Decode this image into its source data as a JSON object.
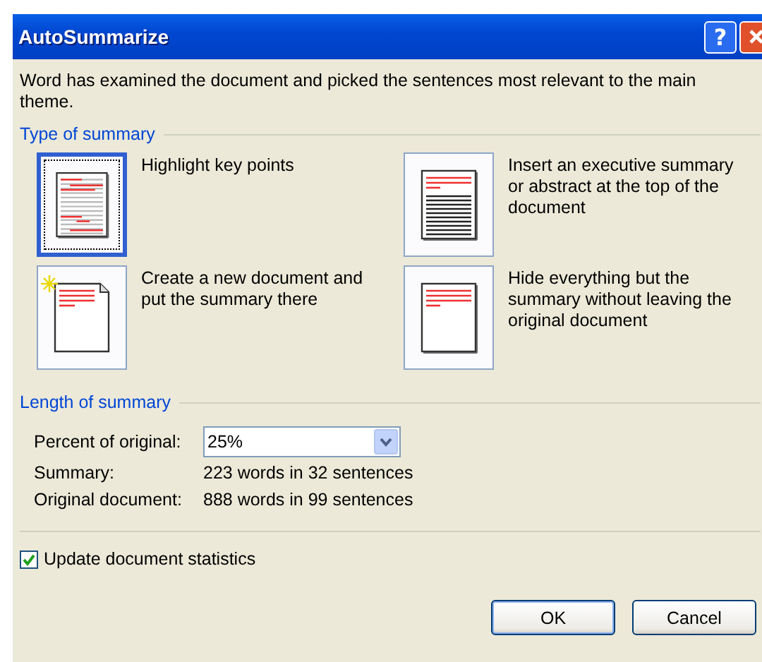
{
  "window": {
    "title": "AutoSummarize",
    "help_button": "?"
  },
  "intro": "Word has examined the document and picked the sentences most relevant to the main theme.",
  "type_of_summary": {
    "label": "Type of summary",
    "options": [
      {
        "kind": "highlight",
        "label": "Highlight key points",
        "selected": true
      },
      {
        "kind": "executive",
        "label": "Insert an executive summary or abstract at the top of the document",
        "selected": false
      },
      {
        "kind": "new-document",
        "label": "Create a new document and put the summary there",
        "selected": false
      },
      {
        "kind": "hide",
        "label": "Hide everything but the summary without leaving the original document",
        "selected": false
      }
    ]
  },
  "length_of_summary": {
    "label": "Length of summary",
    "percent_label": "Percent of original:",
    "percent_value": "25%",
    "stats": [
      {
        "label": "Summary:",
        "value": "223 words in 32 sentences"
      },
      {
        "label": "Original document:",
        "value": "888 words in 99 sentences"
      }
    ]
  },
  "update_statistics": {
    "label": "Update document statistics",
    "checked": true
  },
  "buttons": [
    "OK",
    "Cancel"
  ]
}
